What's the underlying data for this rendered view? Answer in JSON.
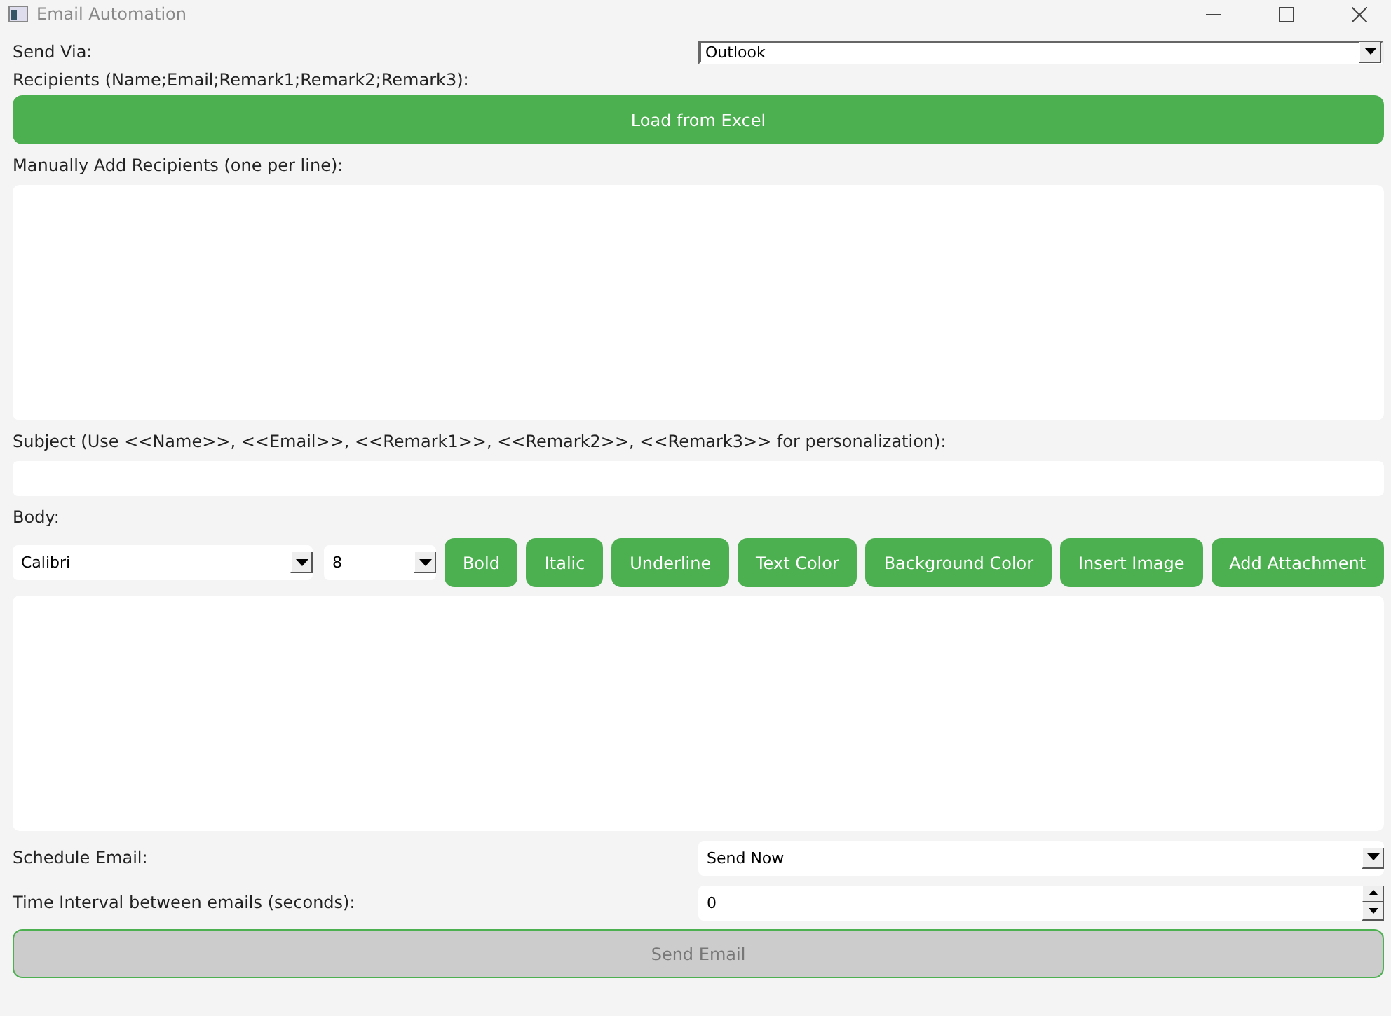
{
  "window": {
    "title": "Email Automation"
  },
  "send_via": {
    "label": "Send Via:",
    "value": "Outlook"
  },
  "recipients": {
    "label": "Recipients (Name;Email;Remark1;Remark2;Remark3):",
    "load_button": "Load from Excel"
  },
  "manual": {
    "label": "Manually Add Recipients (one per line):"
  },
  "subject": {
    "label": "Subject (Use <<Name>>, <<Email>>, <<Remark1>>, <<Remark2>>, <<Remark3>> for personalization):"
  },
  "body": {
    "label": "Body:",
    "font": "Calibri",
    "size": "8",
    "buttons": [
      "Bold",
      "Italic",
      "Underline",
      "Text Color",
      "Background Color",
      "Insert Image",
      "Add Attachment"
    ]
  },
  "schedule": {
    "label": "Schedule Email:",
    "value": "Send Now"
  },
  "interval": {
    "label": "Time Interval between emails (seconds):",
    "value": "0"
  },
  "send_button": {
    "label": "Send Email",
    "disabled": true
  }
}
